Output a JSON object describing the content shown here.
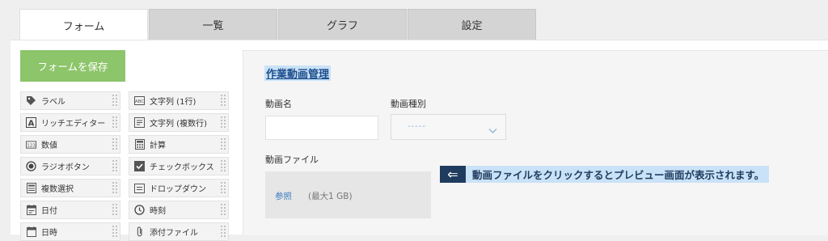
{
  "tabs": [
    {
      "label": "フォーム",
      "active": true
    },
    {
      "label": "一覧"
    },
    {
      "label": "グラフ"
    },
    {
      "label": "設定"
    }
  ],
  "save_button": "フォームを保存",
  "palette": [
    {
      "label": "ラベル",
      "icon": "tag-icon"
    },
    {
      "label": "文字列 (1行)",
      "icon": "abc-text-icon"
    },
    {
      "label": "リッチエディター",
      "icon": "rich-editor-icon"
    },
    {
      "label": "文字列 (複数行)",
      "icon": "multiline-text-icon"
    },
    {
      "label": "数値",
      "icon": "number-icon"
    },
    {
      "label": "計算",
      "icon": "calculator-icon"
    },
    {
      "label": "ラジオボタン",
      "icon": "radio-icon"
    },
    {
      "label": "チェックボックス",
      "icon": "checkbox-icon"
    },
    {
      "label": "複数選択",
      "icon": "multi-select-icon"
    },
    {
      "label": "ドロップダウン",
      "icon": "dropdown-icon"
    },
    {
      "label": "日付",
      "icon": "calendar-icon"
    },
    {
      "label": "時刻",
      "icon": "clock-icon"
    },
    {
      "label": "日時",
      "icon": "datetime-icon"
    },
    {
      "label": "添付ファイル",
      "icon": "paperclip-icon"
    }
  ],
  "form": {
    "title": "作業動画管理",
    "field_name_label": "動画名",
    "field_type_label": "動画種別",
    "field_type_value": "-----",
    "file_label": "動画ファイル",
    "browse_label": "参照",
    "max_size": "(最大1 GB)"
  },
  "callout": {
    "arrow": "⇐",
    "text": "動画ファイルをクリックするとプレビュー画面が表示されます。"
  },
  "colors": {
    "save_button": "#8cc56a",
    "title_highlight": "#c9e2f7",
    "callout_dark": "#1f3c5f",
    "link": "#3c7fc1"
  }
}
